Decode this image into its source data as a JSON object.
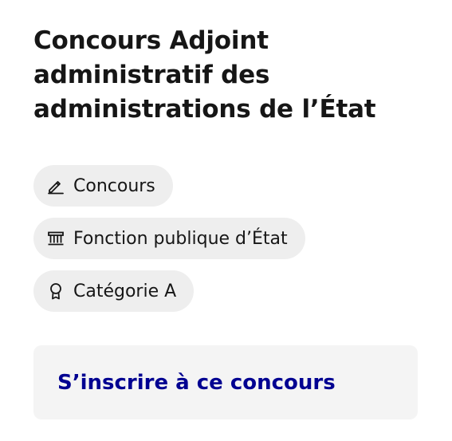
{
  "card": {
    "title": "Concours Adjoint administratif des administrations de l’État",
    "tags": [
      {
        "label": "Concours",
        "icon": "pencil-icon"
      },
      {
        "label": "Fonction publique d’État",
        "icon": "government-building-icon"
      },
      {
        "label": "Catégorie A",
        "icon": "award-ribbon-icon"
      }
    ],
    "cta": {
      "label": "S’inscrire à ce concours",
      "color": "#000091",
      "background": "#f4f4f4"
    }
  },
  "colors": {
    "text": "#161616",
    "tag_background": "#eeeeee",
    "accent": "#000091"
  }
}
